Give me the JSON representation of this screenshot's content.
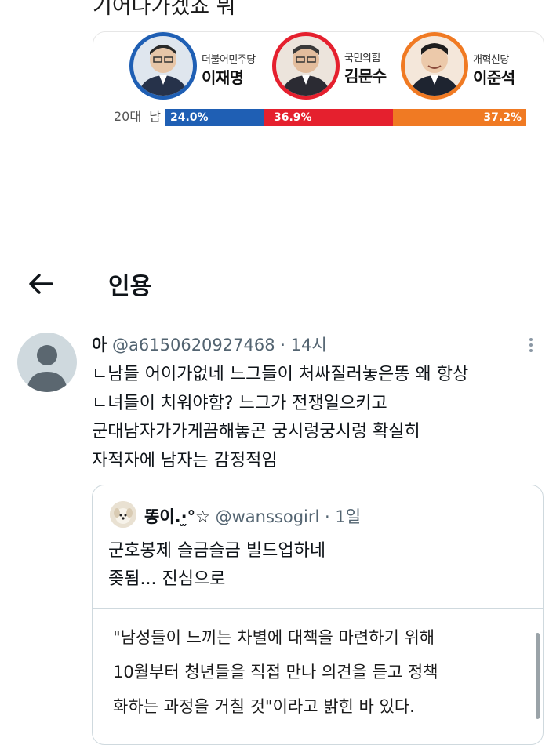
{
  "top_tweet": {
    "text": "기어나가겠죠 뭐"
  },
  "poll_image": {
    "candidates": [
      {
        "party": "더불어민주당",
        "name": "이재명",
        "color": "#1f5fb4"
      },
      {
        "party": "국민의힘",
        "name": "김문수",
        "color": "#e5202e"
      },
      {
        "party": "개혁신당",
        "name": "이준석",
        "color": "#f07a23"
      }
    ],
    "row_label": "20대",
    "row_gender": "남",
    "values": [
      "24.0%",
      "36.9%",
      "37.2%"
    ]
  },
  "header": {
    "title": "인용",
    "back_icon": "arrow-left-icon"
  },
  "tweet": {
    "author_name": "아",
    "handle": "@a6150620927468",
    "time": "14시",
    "lines": [
      "ㄴ남들 어이가없네 느그들이 처싸질러놓은똥 왜 항상",
      "ㄴ녀들이 치워야함? 느그가 전쟁일으키고",
      "군대남자가가게끔해놓곤 궁시렁궁시렁 확실히",
      "자적자에 남자는 감정적임"
    ]
  },
  "quote": {
    "author_name": "똥이.·̫°☆",
    "handle": "@wanssogirl",
    "time": "1일",
    "lines": [
      "군호봉제 슬금슬금 빌드업하네",
      "좆됨... 진심으로"
    ],
    "inner_lines": [
      "\"남성들이 느끼는 차별에 대책을 마련하기 위해",
      "10월부터 청년들을 직접 만나 의견을 듣고 정책",
      "화하는 과정을 거칠 것\"이라고 밝힌 바 있다."
    ]
  },
  "colors": {
    "text": "#0f1419",
    "secondary": "#536471",
    "border": "#cfd9de"
  }
}
